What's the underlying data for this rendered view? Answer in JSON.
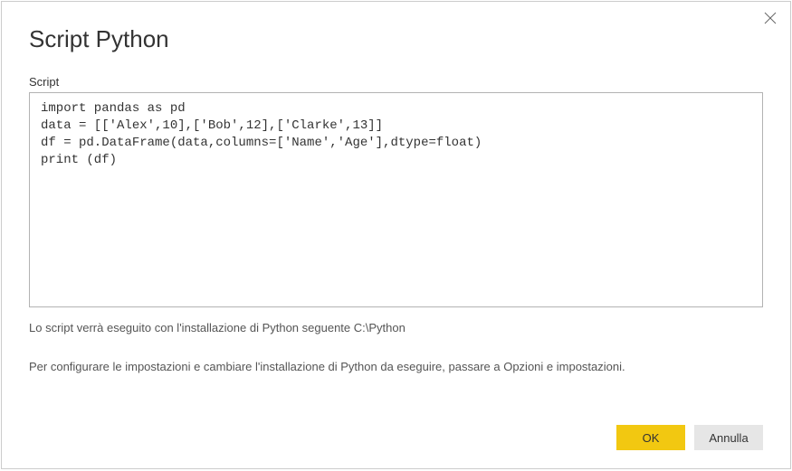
{
  "dialog": {
    "title": "Script Python",
    "field_label": "Script",
    "script_content": "import pandas as pd\ndata = [['Alex',10],['Bob',12],['Clarke',13]]\ndf = pd.DataFrame(data,columns=['Name','Age'],dtype=float)\nprint (df)",
    "info_install": "Lo script verrà eseguito con l'installazione di Python seguente C:\\Python",
    "info_settings": "Per configurare le impostazioni e cambiare l'installazione di Python da eseguire, passare a Opzioni e impostazioni."
  },
  "buttons": {
    "ok": "OK",
    "cancel": "Annulla"
  }
}
